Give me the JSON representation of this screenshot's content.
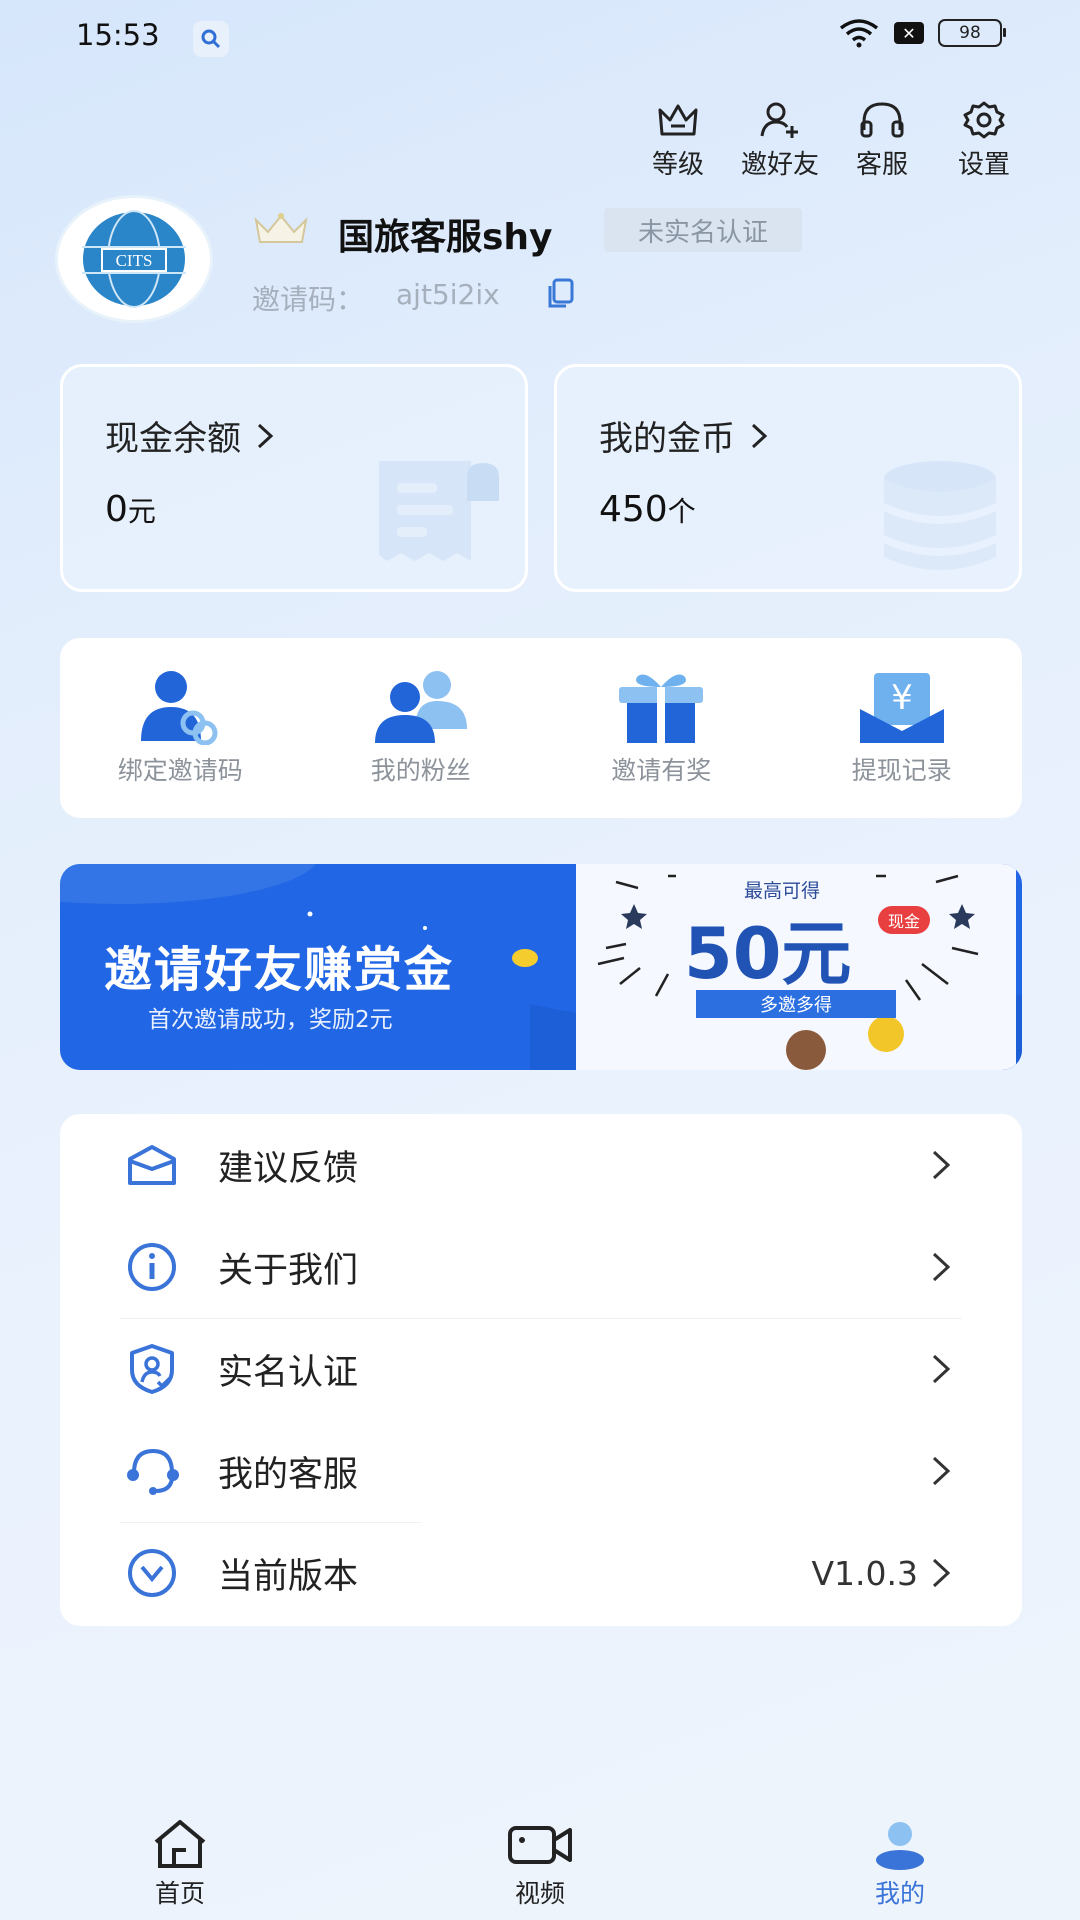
{
  "status_bar": {
    "time": "15:53",
    "battery": "98"
  },
  "top_actions": [
    {
      "label": "等级",
      "icon": "crown-outline-icon"
    },
    {
      "label": "邀好友",
      "icon": "add-user-icon"
    },
    {
      "label": "客服",
      "icon": "headphones-icon"
    },
    {
      "label": "设置",
      "icon": "gear-icon"
    }
  ],
  "profile": {
    "avatar_text": "CITS",
    "username": "国旅客服shy",
    "verify_status": "未实名认证",
    "invite_label": "邀请码：",
    "invite_code": "ajt5i2ix"
  },
  "balances": {
    "cash": {
      "title": "现金余额",
      "value": "0",
      "unit": "元"
    },
    "coins": {
      "title": "我的金币",
      "value": "450",
      "unit": "个"
    }
  },
  "quick_actions": [
    {
      "label": "绑定邀请码",
      "icon": "bind-invite-icon"
    },
    {
      "label": "我的粉丝",
      "icon": "fans-icon"
    },
    {
      "label": "邀请有奖",
      "icon": "gift-icon"
    },
    {
      "label": "提现记录",
      "icon": "withdraw-record-icon"
    }
  ],
  "banner": {
    "title": "邀请好友赚赏金",
    "subtitle": "首次邀请成功，奖励2元",
    "top_text": "最高可得",
    "amount": "50元",
    "cash_tag": "现金",
    "button": "多邀多得"
  },
  "menu": [
    {
      "label": "建议反馈",
      "icon": "feedback-icon",
      "value": ""
    },
    {
      "label": "关于我们",
      "icon": "info-icon",
      "value": ""
    },
    {
      "label": "实名认证",
      "icon": "shield-user-icon",
      "value": ""
    },
    {
      "label": "我的客服",
      "icon": "headset-icon",
      "value": ""
    },
    {
      "label": "当前版本",
      "icon": "version-icon",
      "value": "V1.0.3"
    }
  ],
  "bottom_nav": [
    {
      "label": "首页",
      "icon": "home-icon",
      "active": false
    },
    {
      "label": "视频",
      "icon": "video-icon",
      "active": false
    },
    {
      "label": "我的",
      "icon": "profile-icon",
      "active": true
    }
  ],
  "colors": {
    "accent": "#3a74d8",
    "banner_blue": "#2166e4"
  }
}
